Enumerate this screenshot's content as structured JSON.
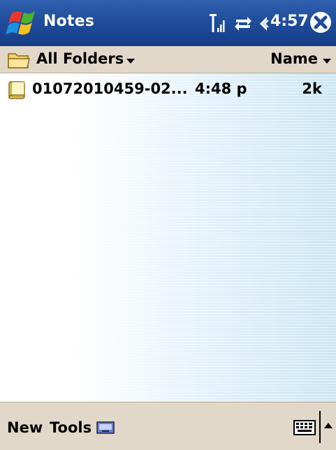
{
  "titlebar": {
    "app_title": "Notes",
    "clock": "4:57",
    "icons": [
      "windows-start-icon",
      "signal-icon",
      "connectivity-icon",
      "volume-icon",
      "close-icon"
    ]
  },
  "folderbar": {
    "folder_label": "All Folders",
    "sort_label": "Name"
  },
  "list": {
    "items": [
      {
        "name": "01072010459-02...",
        "time": "4:48 p",
        "size": "2k",
        "icon": "note-file-icon"
      }
    ]
  },
  "menubar": {
    "new_label": "New",
    "tools_label": "Tools",
    "icons": [
      "input-panel-icon",
      "keyboard-icon",
      "sip-up-arrow-icon"
    ]
  },
  "colors": {
    "titlebar": "#1d4a99",
    "bars": "#e2d8ca",
    "list_gradient_end": "#cce6f4"
  }
}
